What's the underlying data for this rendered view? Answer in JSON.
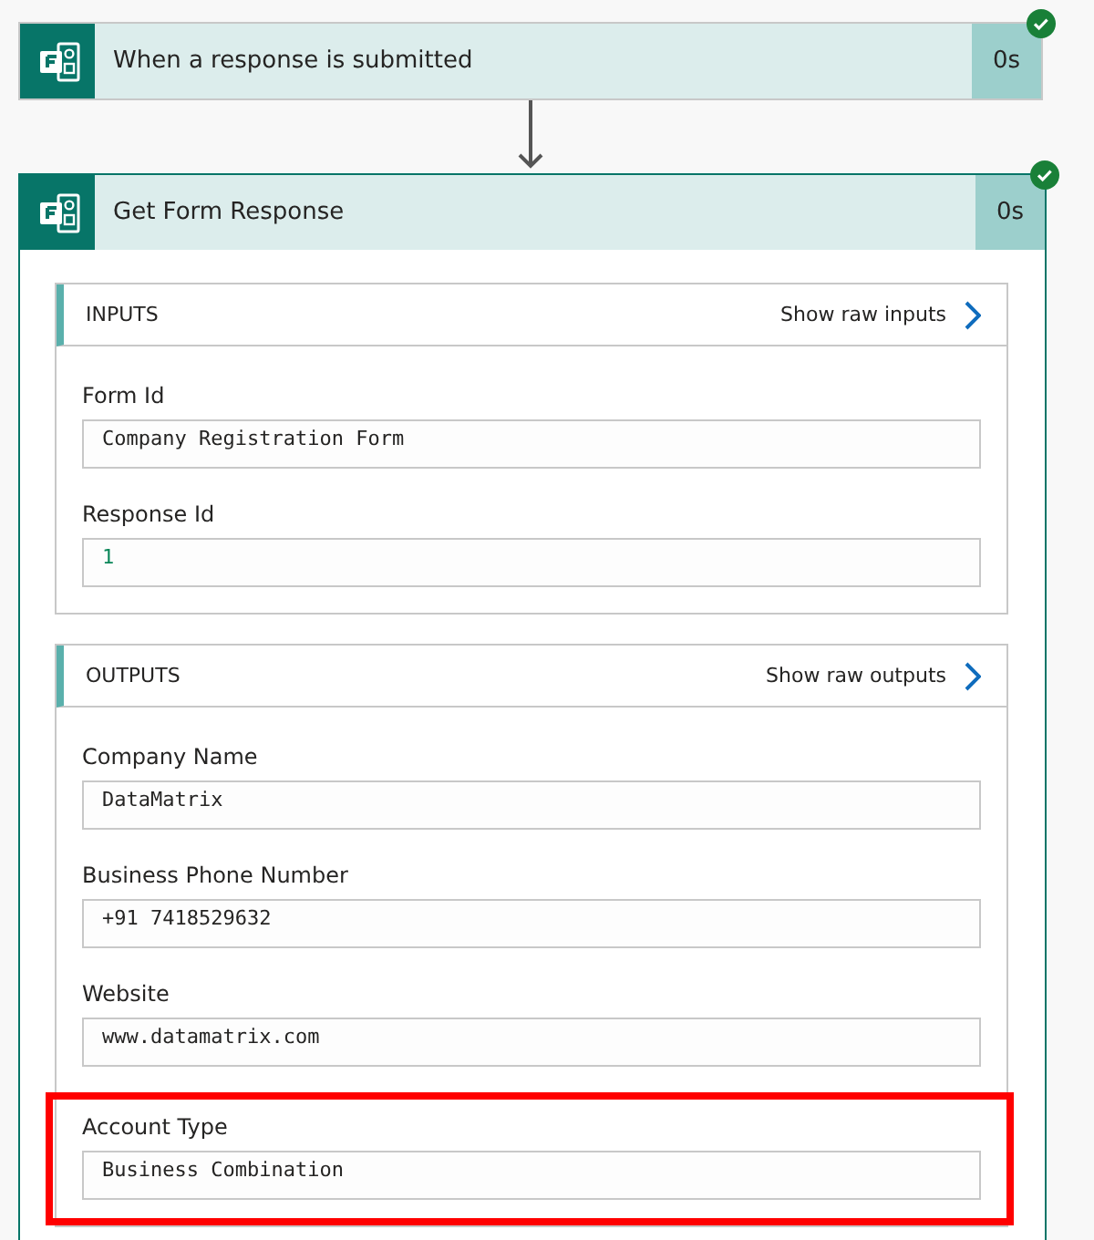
{
  "steps": [
    {
      "title": "When a response is submitted",
      "duration": "0s",
      "succeeded": true,
      "expanded": false
    },
    {
      "title": "Get Form Response",
      "duration": "0s",
      "succeeded": true,
      "expanded": true,
      "sections": [
        {
          "title": "INPUTS",
          "link": "Show raw inputs",
          "fields": [
            {
              "label": "Form Id",
              "value": "Company Registration Form",
              "kind": "text",
              "highlighted": false
            },
            {
              "label": "Response Id",
              "value": "1",
              "kind": "number",
              "highlighted": false
            }
          ]
        },
        {
          "title": "OUTPUTS",
          "link": "Show raw outputs",
          "fields": [
            {
              "label": "Company Name",
              "value": "DataMatrix",
              "kind": "text",
              "highlighted": false
            },
            {
              "label": "Business Phone Number",
              "value": "+91 7418529632",
              "kind": "text",
              "highlighted": false
            },
            {
              "label": "Website",
              "value": "www.datamatrix.com",
              "kind": "text",
              "highlighted": false
            },
            {
              "label": "Account Type",
              "value": "Business Combination",
              "kind": "text",
              "highlighted": true
            }
          ]
        }
      ]
    }
  ]
}
